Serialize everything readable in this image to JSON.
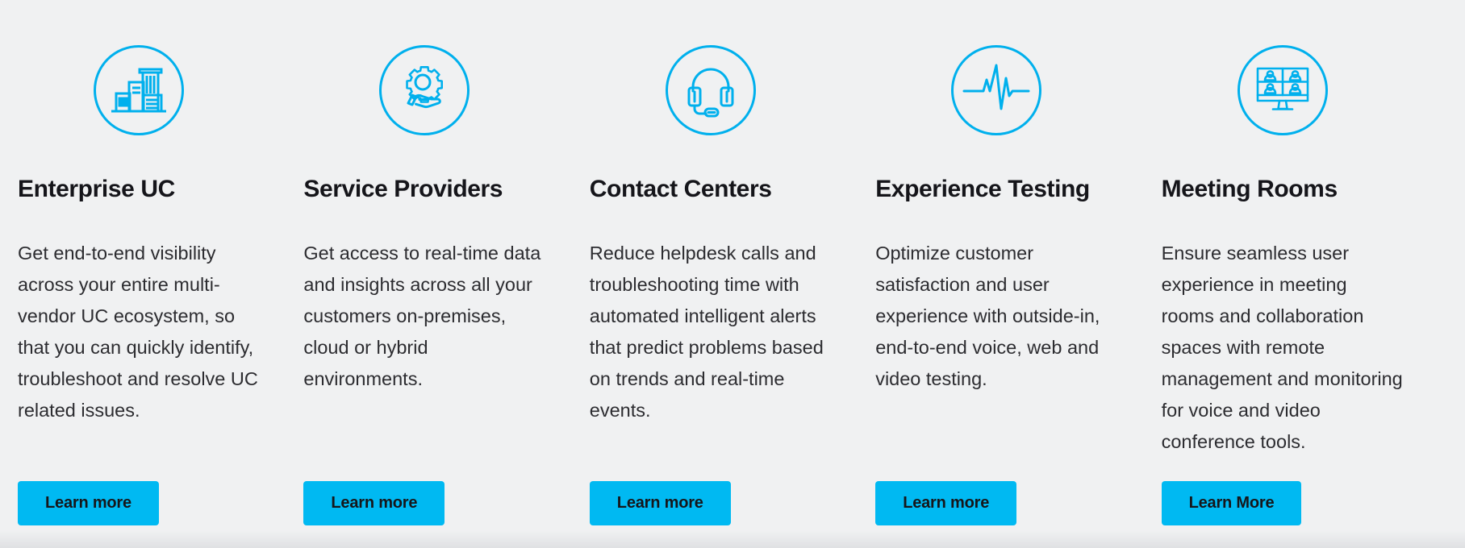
{
  "theme": {
    "background": "#f0f1f2",
    "accent": "#00b9f2",
    "icon_stroke": "#00b0ed",
    "heading_color": "#15151a",
    "body_color": "#2c2c30",
    "button_text_color": "#16161a"
  },
  "cards": [
    {
      "icon": "office-buildings-icon",
      "title": "Enterprise UC",
      "description": "Get end-to-end visibility across your entire multi-vendor UC ecosystem, so that you can quickly identify, troubleshoot and resolve UC related issues.",
      "button_label": "Learn more"
    },
    {
      "icon": "gear-in-hand-icon",
      "title": "Service Providers",
      "description": "Get access to real-time data and insights across all your customers on-premises, cloud or hybrid environments.",
      "button_label": "Learn more"
    },
    {
      "icon": "headset-icon",
      "title": "Contact Centers",
      "description": "Reduce helpdesk calls and troubleshooting time with automated intelligent alerts that predict problems based on trends and real-time events.",
      "button_label": "Learn more"
    },
    {
      "icon": "pulse-waveform-icon",
      "title": "Experience Testing",
      "description": "Optimize customer satisfaction and user experience with outside-in, end-to-end voice, web and video testing.",
      "button_label": "Learn more"
    },
    {
      "icon": "video-conference-screen-icon",
      "title": "Meeting Rooms",
      "description": "Ensure seamless user experience in meeting rooms and collaboration spaces with remote management and monitoring for voice and video conference tools.",
      "button_label": "Learn More"
    }
  ]
}
